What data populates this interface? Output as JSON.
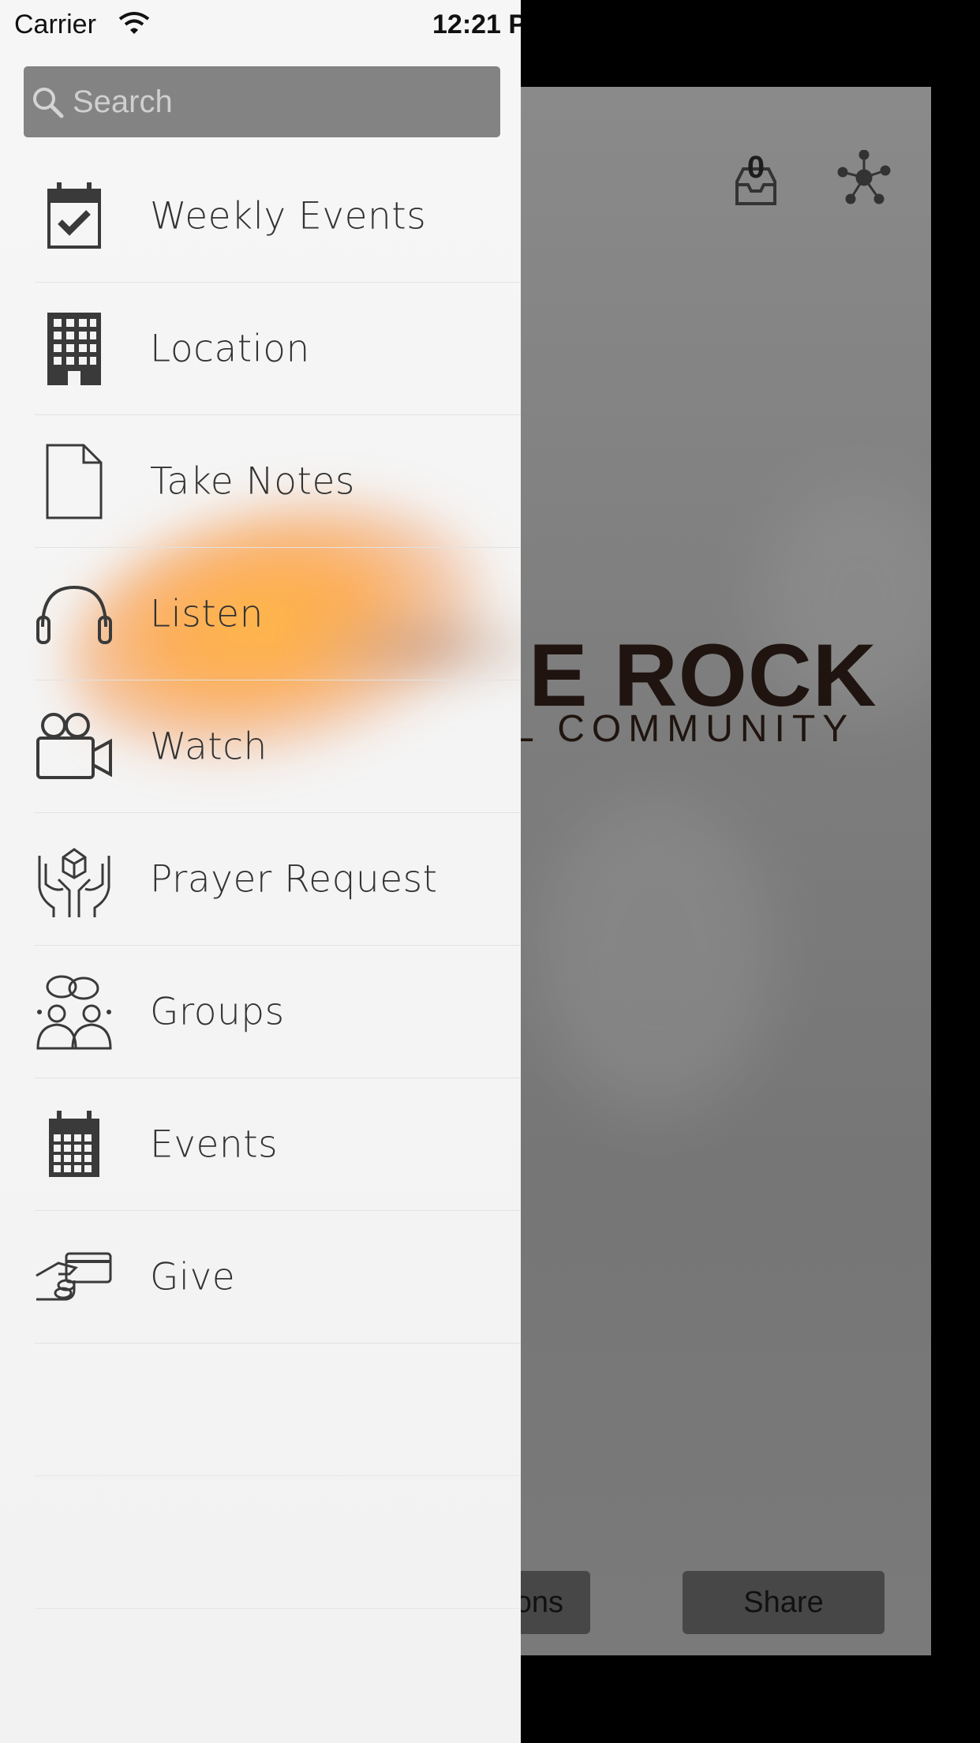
{
  "status_bar": {
    "carrier": "Carrier",
    "time": "12:21 P"
  },
  "search": {
    "placeholder": "Search"
  },
  "menu": {
    "items": [
      {
        "label": "Weekly Events",
        "icon": "calendar-check-icon"
      },
      {
        "label": "Location",
        "icon": "building-icon"
      },
      {
        "label": "Take Notes",
        "icon": "document-icon"
      },
      {
        "label": "Listen",
        "icon": "headphones-icon"
      },
      {
        "label": "Watch",
        "icon": "video-camera-icon"
      },
      {
        "label": "Prayer Request",
        "icon": "hands-box-icon"
      },
      {
        "label": "Groups",
        "icon": "people-chat-icon"
      },
      {
        "label": "Events",
        "icon": "calendar-grid-icon"
      },
      {
        "label": "Give",
        "icon": "hand-card-icon"
      }
    ]
  },
  "background_app": {
    "inbox_count": "0",
    "logo_main": "E ROCK",
    "logo_sub": "L COMMUNITY",
    "buttons": {
      "left_label": "ons",
      "right_label": "Share"
    }
  },
  "colors": {
    "drawer_bg": "#f4f4f4",
    "search_bg": "#838383",
    "icon_color": "#3a3a3a",
    "label_color": "#333333",
    "flare_accent": "#ff9a2e"
  }
}
